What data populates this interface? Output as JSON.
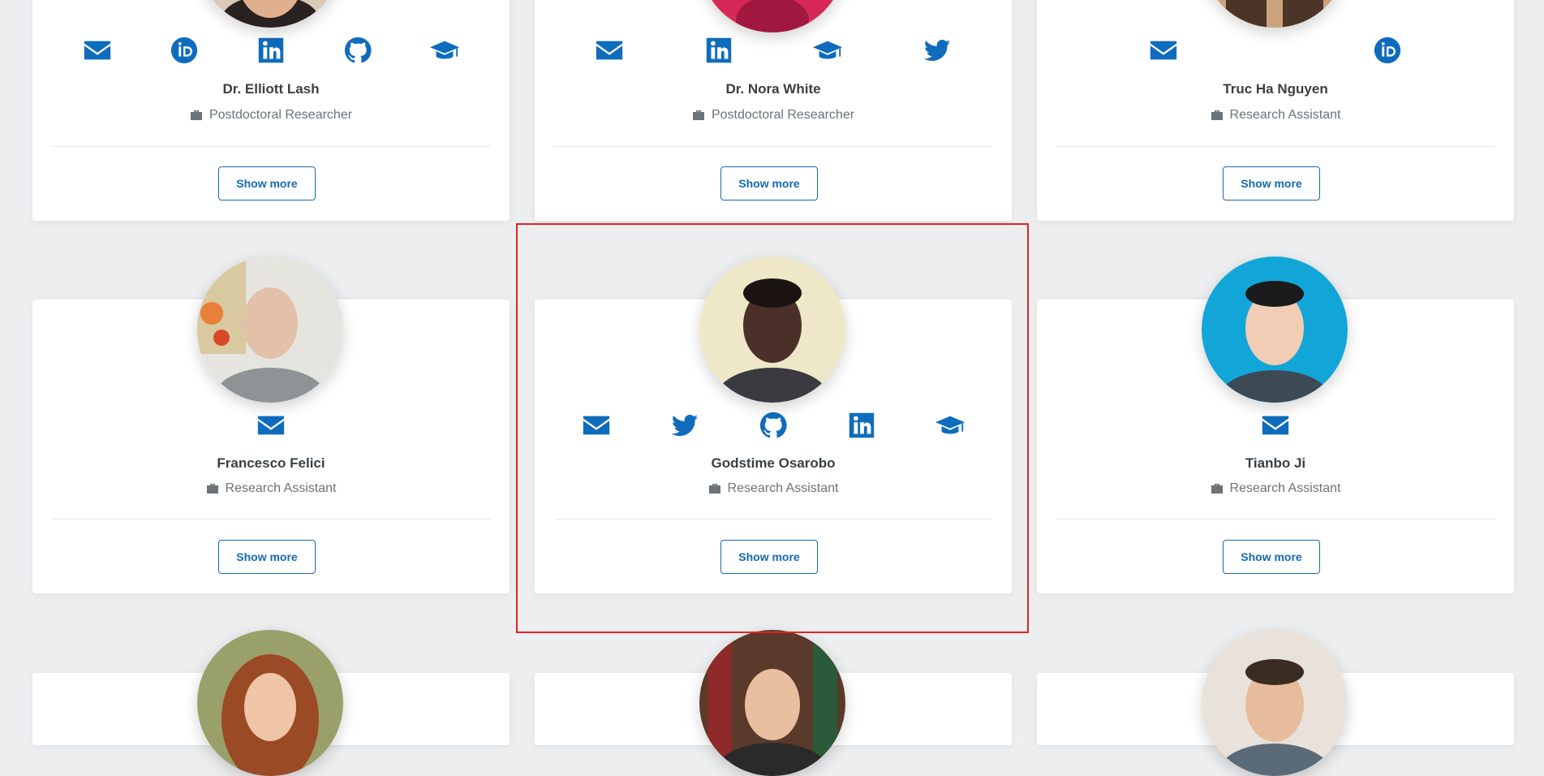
{
  "colors": {
    "accent": "#0f6cbd",
    "highlight": "#e52222"
  },
  "button_label": "Show more",
  "cards": [
    {
      "name": "Dr. Elliott Lash",
      "role": "Postdoctoral Researcher",
      "icons": [
        "envelope-icon",
        "orcid-icon",
        "linkedin-icon",
        "github-icon",
        "graduation-cap-icon"
      ]
    },
    {
      "name": "Dr. Nora White",
      "role": "Postdoctoral Researcher",
      "icons": [
        "envelope-icon",
        "linkedin-icon",
        "graduation-cap-icon",
        "twitter-icon"
      ]
    },
    {
      "name": "Truc Ha Nguyen",
      "role": "Research Assistant",
      "icons": [
        "envelope-icon",
        "orcid-icon"
      ]
    },
    {
      "name": "Francesco Felici",
      "role": "Research Assistant",
      "icons": [
        "envelope-icon"
      ]
    },
    {
      "name": "Godstime Osarobo",
      "role": "Research Assistant",
      "icons": [
        "envelope-icon",
        "twitter-icon",
        "github-icon",
        "linkedin-icon",
        "graduation-cap-icon"
      ]
    },
    {
      "name": "Tianbo Ji",
      "role": "Research Assistant",
      "icons": [
        "envelope-icon"
      ]
    }
  ]
}
